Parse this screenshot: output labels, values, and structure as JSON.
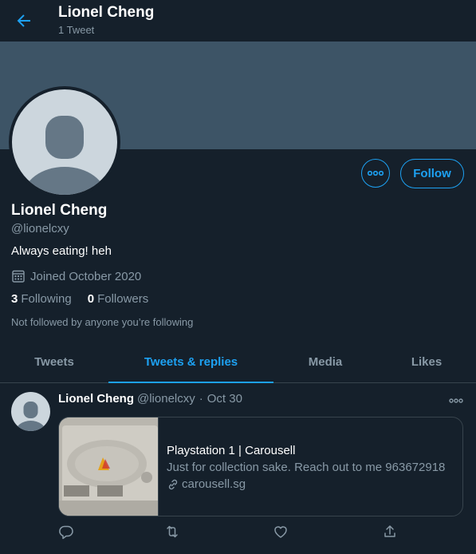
{
  "header": {
    "name": "Lionel Cheng",
    "tweet_count": "1 Tweet",
    "back_icon": "arrow-left-icon"
  },
  "profile": {
    "name": "Lionel Cheng",
    "handle": "@lionelcxy",
    "bio": "Always eating! heh",
    "joined": "Joined October 2020",
    "following_count": "3",
    "following_label": "Following",
    "followers_count": "0",
    "followers_label": "Followers",
    "not_followed": "Not followed by anyone you’re following",
    "follow_button": "Follow"
  },
  "tabs": [
    {
      "label": "Tweets",
      "active": false
    },
    {
      "label": "Tweets & replies",
      "active": true
    },
    {
      "label": "Media",
      "active": false
    },
    {
      "label": "Likes",
      "active": false
    }
  ],
  "tweet": {
    "name": "Lionel Cheng",
    "handle": "@lionelcxy",
    "separator": "·",
    "date": "Oct 30",
    "card": {
      "title": "Playstation 1 | Carousell",
      "description": "Just for collection sake. Reach out to me 963672918",
      "link": "carousell.sg"
    }
  },
  "colors": {
    "background": "#15202b",
    "banner": "#3d5466",
    "accent": "#1da1f2",
    "muted": "#8899a6"
  }
}
